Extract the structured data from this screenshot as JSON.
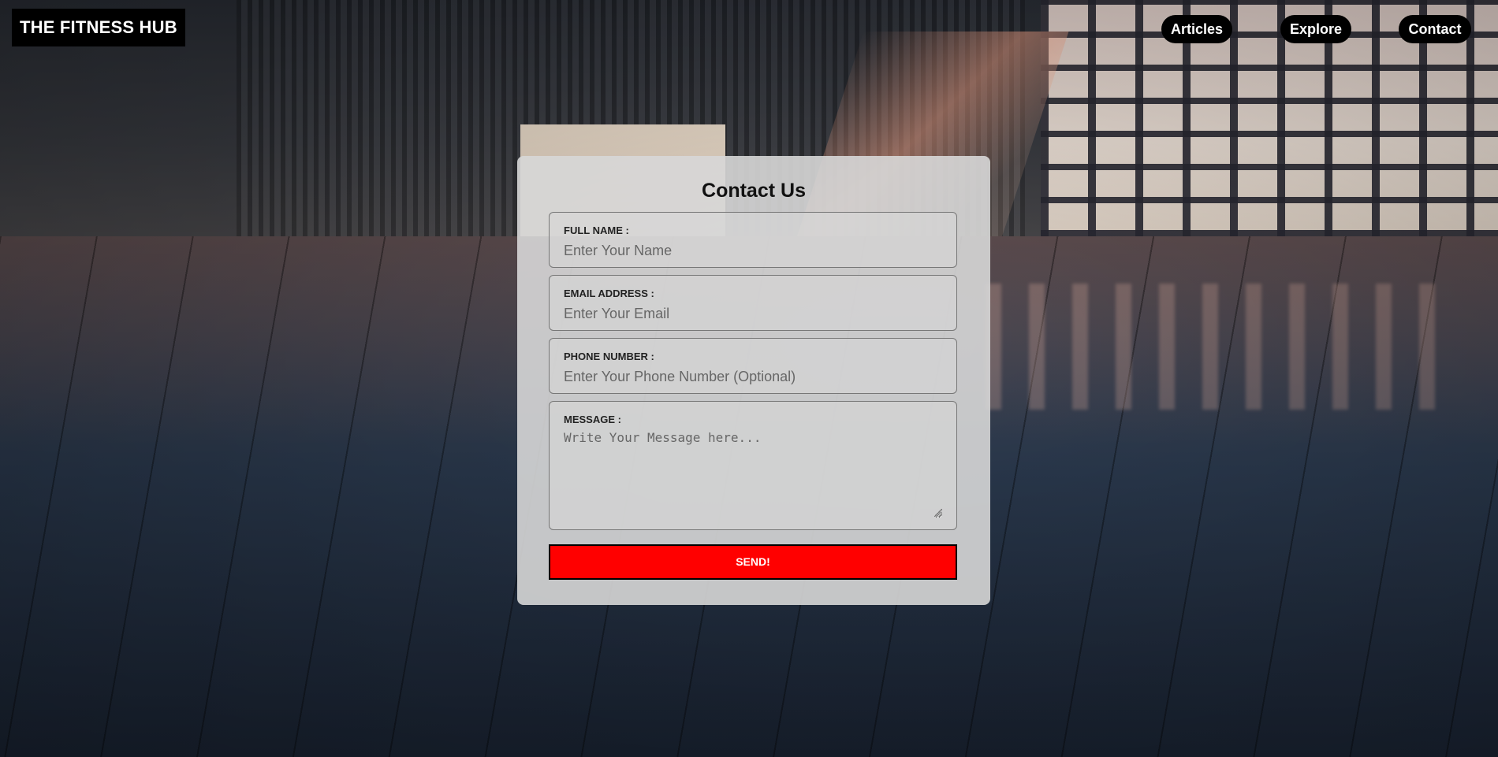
{
  "header": {
    "logo": "THE FITNESS HUB",
    "nav": [
      {
        "label": "Articles"
      },
      {
        "label": "Explore"
      },
      {
        "label": "Contact"
      }
    ]
  },
  "contact_form": {
    "title": "Contact Us",
    "fields": {
      "full_name": {
        "label": "FULL NAME :",
        "placeholder": "Enter Your Name",
        "value": ""
      },
      "email": {
        "label": "EMAIL ADDRESS :",
        "placeholder": "Enter Your Email",
        "value": ""
      },
      "phone": {
        "label": "PHONE NUMBER :",
        "placeholder": "Enter Your Phone Number (Optional)",
        "value": ""
      },
      "message": {
        "label": "MESSAGE :",
        "placeholder": "Write Your Message here...",
        "value": ""
      }
    },
    "submit_label": "SEND!"
  },
  "colors": {
    "accent": "#ff0000",
    "nav_bg": "#000000",
    "card_bg": "#d7d7d7"
  }
}
